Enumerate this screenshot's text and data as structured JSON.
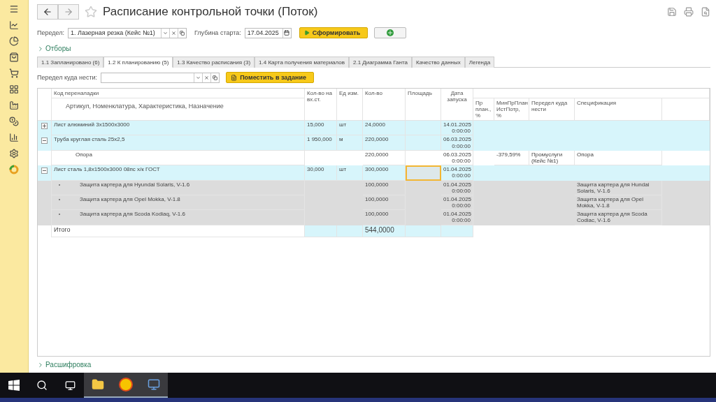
{
  "title": "Расписание контрольной точки (Поток)",
  "filters": {
    "division_label": "Передел:",
    "division_value": "1. Лазерная резка (Кейс №1)",
    "depth_label": "Глубина старта:",
    "depth_value": "17.04.2025",
    "run_button": "Сформировать"
  },
  "selections_toggle": "Отборы",
  "tabs": [
    {
      "label": "1.1 Запланировано (6)",
      "selected": false
    },
    {
      "label": "1.2 К планированию (5)",
      "selected": true
    },
    {
      "label": "1.3 Качество расписания (3)",
      "selected": false
    },
    {
      "label": "1.4 Карта получения материалов",
      "selected": false
    },
    {
      "label": "2.1 Диаграмма Ганта",
      "selected": false
    },
    {
      "label": "Качество данных",
      "selected": false
    },
    {
      "label": "Легенда",
      "selected": false
    }
  ],
  "toolbar": {
    "target_label": "Передел куда нести:",
    "place_button": "Поместить в задание"
  },
  "table": {
    "header_top": [
      "Код переналадки",
      "Кол-во на вх.ст.",
      "Ед изм.",
      "Кол-во",
      "Площадь",
      "Дата запуска"
    ],
    "header_bottom": [
      "Артикул, Номенклатура, Характеристика, Назначение",
      "Пр план., %",
      "МинПрПлан ИстПотр, %",
      "Передел куда нести",
      "Спецификация"
    ],
    "rows": [
      {
        "kind": "material",
        "expanded": false,
        "area_focused": false,
        "name": "Лист алюминий 3х1500х3000",
        "qty_in": "15,000",
        "unit": "шт",
        "qty": "24,0000",
        "date": "14.01.2025",
        "time": "0:00:00",
        "children": []
      },
      {
        "kind": "material",
        "expanded": true,
        "area_focused": false,
        "name": "Труба круглая сталь 25х2,5",
        "qty_in": "1 950,000",
        "unit": "м",
        "qty": "220,0000",
        "date": "06.03.2025",
        "time": "0:00:00",
        "children": [
          {
            "kind": "usage",
            "name": "Опора",
            "qty": "220,0000",
            "date": "06.03.2025",
            "time": "0:00:00",
            "min_pct": "-379,59%",
            "target": "Промуслуги (Кейс №1)",
            "spec": "Опора"
          }
        ]
      },
      {
        "kind": "material",
        "expanded": true,
        "area_focused": true,
        "name": "Лист сталь 1,8х1500х3000 08пс х/к ГОСТ",
        "qty_in": "30,000",
        "unit": "шт",
        "qty": "300,0000",
        "date": "01.04.2025",
        "time": "0:00:00",
        "children": [
          {
            "kind": "part",
            "name": "Защита картера для Hyundai Solaris, V-1.6",
            "qty": "100,0000",
            "date": "01.04.2025",
            "time": "0:00:00",
            "spec": "Защита картера для Hundai Solaris, V-1.6"
          },
          {
            "kind": "part",
            "name": "Защита картера для Opel Mokka, V-1.8",
            "qty": "100,0000",
            "date": "01.04.2025",
            "time": "0:00:00",
            "spec": "Защита картера для Opel Mokka, V-1.8"
          },
          {
            "kind": "part",
            "name": "Защита картера для Scoda Kodiaq, V-1.6",
            "qty": "100,0000",
            "date": "01.04.2025",
            "time": "0:00:00",
            "spec": "Защита картера для Scoda Codiac, V-1.6"
          }
        ]
      }
    ],
    "total_label": "Итого",
    "total_qty": "544,0000"
  },
  "details_toggle": "Расшифровка"
}
